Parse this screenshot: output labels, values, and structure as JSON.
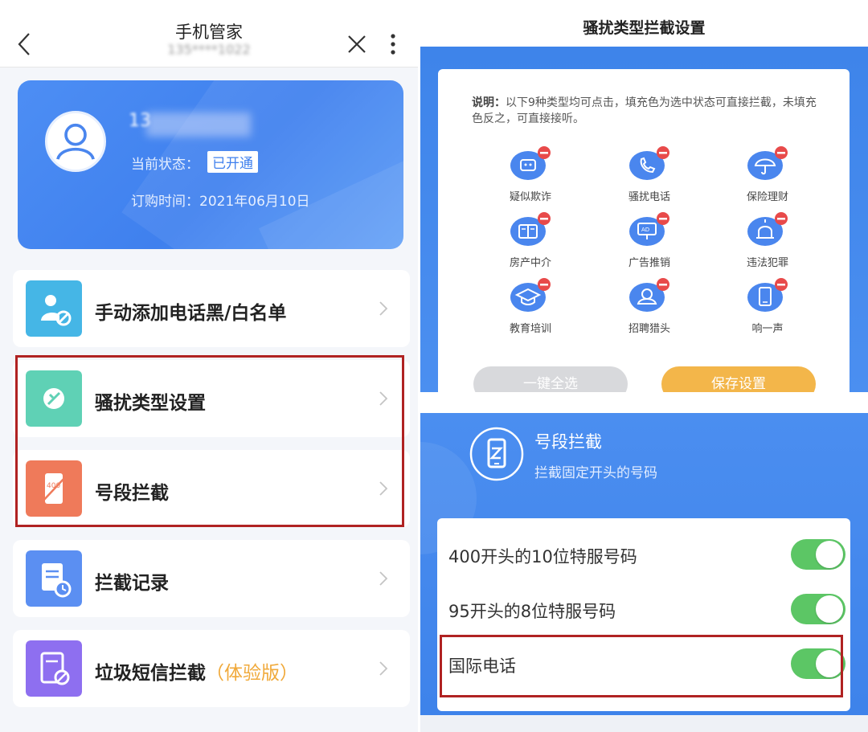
{
  "left": {
    "nav": {
      "title": "手机管家",
      "subtitle": "135****1022"
    },
    "user": {
      "number": "13",
      "status_label": "当前状态：",
      "status_value": "已开通",
      "order_time": "订购时间：2021年06月10日"
    },
    "menu": [
      {
        "label": "手动添加电话黑/白名单",
        "icon": "blacklist-icon",
        "color": "#45b6e6"
      },
      {
        "label": "骚扰类型设置",
        "icon": "harass-type-icon",
        "color": "#5fd1b5"
      },
      {
        "label": "号段拦截",
        "icon": "number-segment-icon",
        "color": "#ef7a5a"
      },
      {
        "label": "拦截记录",
        "icon": "record-icon",
        "color": "#5b8ff2"
      },
      {
        "label": "垃圾短信拦截",
        "trial": "（体验版）",
        "icon": "spam-sms-icon",
        "color": "#8e6ff0"
      }
    ]
  },
  "right": {
    "title": "骚扰类型拦截设置",
    "desc_bold": "说明：",
    "desc_text": "以下9种类型均可点击，填充色为选中状态可直接拦截，未填充色反之，可直接接听。",
    "categories": [
      {
        "label": "疑似欺诈",
        "icon": "fraud-icon"
      },
      {
        "label": "骚扰电话",
        "icon": "harass-call-icon"
      },
      {
        "label": "保险理财",
        "icon": "insurance-icon"
      },
      {
        "label": "房产中介",
        "icon": "real-estate-icon"
      },
      {
        "label": "广告推销",
        "icon": "advert-icon"
      },
      {
        "label": "违法犯罪",
        "icon": "crime-alarm-icon"
      },
      {
        "label": "教育培训",
        "icon": "education-icon"
      },
      {
        "label": "招聘猎头",
        "icon": "recruit-icon"
      },
      {
        "label": "响一声",
        "icon": "ring-once-icon"
      }
    ],
    "btn_select_all": "一键全选",
    "btn_save": "保存设置",
    "segment": {
      "title": "号段拦截",
      "subtitle": "拦截固定开头的号码"
    },
    "options": [
      {
        "label": "400开头的10位特服号码",
        "on": true
      },
      {
        "label": "95开头的8位特服号码",
        "on": true
      },
      {
        "label": "国际电话",
        "on": true
      }
    ],
    "colors": {
      "primary_blue": "#3f80ee",
      "toggle_green": "#5cc665",
      "save_orange": "#f3b64a",
      "highlight_red": "#b02222"
    }
  }
}
